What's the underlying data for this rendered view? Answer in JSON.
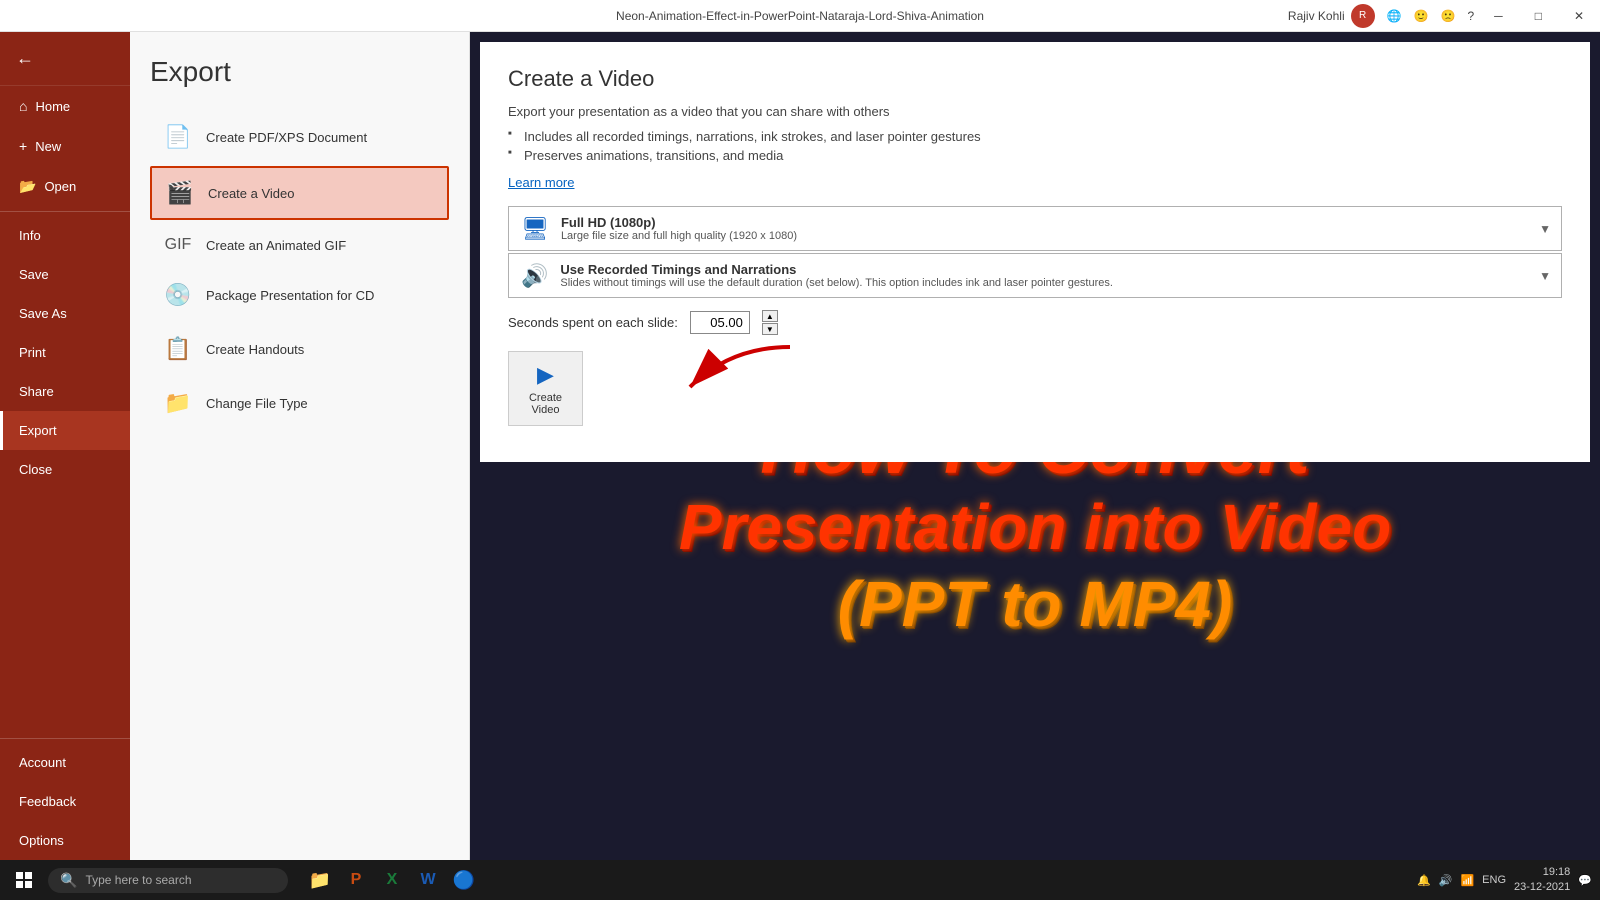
{
  "titlebar": {
    "title": "Neon-Animation-Effect-in-PowerPoint-Nataraja-Lord-Shiva-Animation",
    "user": "Rajiv Kohli",
    "controls": [
      "─",
      "□",
      "✕"
    ]
  },
  "sidebar": {
    "back_label": "",
    "nav_items": [
      {
        "id": "home",
        "label": "Home",
        "icon": "⌂"
      },
      {
        "id": "new",
        "label": "New",
        "icon": "+"
      },
      {
        "id": "open",
        "label": "Open",
        "icon": "📂"
      },
      {
        "id": "divider1",
        "type": "divider"
      },
      {
        "id": "info",
        "label": "Info",
        "icon": ""
      },
      {
        "id": "save",
        "label": "Save",
        "icon": ""
      },
      {
        "id": "saveas",
        "label": "Save As",
        "icon": ""
      },
      {
        "id": "print",
        "label": "Print",
        "icon": ""
      },
      {
        "id": "share",
        "label": "Share",
        "icon": ""
      },
      {
        "id": "export",
        "label": "Export",
        "icon": ""
      },
      {
        "id": "close",
        "label": "Close",
        "icon": ""
      }
    ],
    "bottom_items": [
      {
        "id": "account",
        "label": "Account"
      },
      {
        "id": "feedback",
        "label": "Feedback"
      },
      {
        "id": "options",
        "label": "Options"
      }
    ]
  },
  "export": {
    "title": "Export",
    "items": [
      {
        "id": "pdf",
        "label": "Create PDF/XPS Document",
        "icon": "📄"
      },
      {
        "id": "video",
        "label": "Create a Video",
        "icon": "🎬",
        "active": true
      },
      {
        "id": "gif",
        "label": "Create an Animated GIF",
        "icon": "🖼"
      },
      {
        "id": "cd",
        "label": "Package Presentation for CD",
        "icon": "💿"
      },
      {
        "id": "handouts",
        "label": "Create Handouts",
        "icon": "📋"
      },
      {
        "id": "filetype",
        "label": "Change File Type",
        "icon": "📁"
      }
    ]
  },
  "create_video": {
    "title": "Create a Video",
    "description": "Export your presentation as a video that you can share with others",
    "bullets": [
      "Includes all recorded timings, narrations, ink strokes, and laser pointer gestures",
      "Preserves animations, transitions, and media"
    ],
    "learn_more": "Learn more",
    "quality_option": {
      "main": "Full HD (1080p)",
      "sub": "Large file size and full high quality (1920 x 1080)"
    },
    "timing_option": {
      "main": "Use Recorded Timings and Narrations",
      "sub": "Slides without timings will use the default duration (set below). This option includes ink and laser pointer gestures."
    },
    "seconds_label": "Seconds spent on each slide:",
    "seconds_value": "05.00",
    "create_btn_label": "Create\nVideo"
  },
  "presentation_text": {
    "line1": "How To Convert",
    "line2": "Presentation into Video",
    "line3": "(PPT to MP4)"
  },
  "taskbar": {
    "search_placeholder": "Type here to search",
    "time": "19:18",
    "date": "23-12-2021",
    "lang": "ENG"
  }
}
